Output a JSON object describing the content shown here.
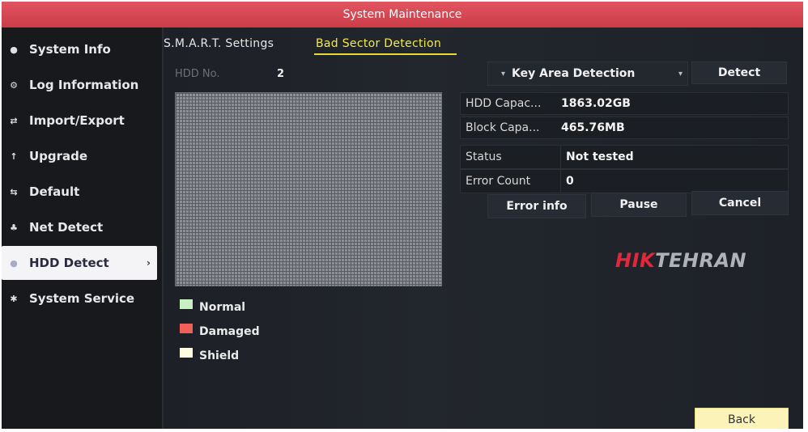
{
  "window": {
    "title": "System Maintenance"
  },
  "sidebar": {
    "items": [
      {
        "label": "System Info",
        "icon": "info-icon",
        "active": false
      },
      {
        "label": "Log Information",
        "icon": "log-icon",
        "active": false
      },
      {
        "label": "Import/Export",
        "icon": "import-export-icon",
        "active": false
      },
      {
        "label": "Upgrade",
        "icon": "upgrade-icon",
        "active": false
      },
      {
        "label": "Default",
        "icon": "default-icon",
        "active": false
      },
      {
        "label": "Net Detect",
        "icon": "network-icon",
        "active": false
      },
      {
        "label": "HDD Detect",
        "icon": "disk-icon",
        "active": true
      },
      {
        "label": "System Service",
        "icon": "gear-icon",
        "active": false
      }
    ]
  },
  "tabs": [
    {
      "label": "S.M.A.R.T. Settings",
      "active": false
    },
    {
      "label": "Bad Sector Detection",
      "active": true
    }
  ],
  "hdd": {
    "label": "HDD No.",
    "value": "2"
  },
  "detection": {
    "mode": "Key Area Detection",
    "detect_label": "Detect"
  },
  "info": {
    "capacity_label": "HDD Capac...",
    "capacity_value": "1863.02GB",
    "block_label": "Block Capa...",
    "block_value": "465.76MB",
    "status_label": "Status",
    "status_value": "Not tested",
    "error_count_label": "Error Count",
    "error_count_value": "0"
  },
  "actions": {
    "error_info": "Error info",
    "pause": "Pause",
    "cancel": "Cancel",
    "back": "Back"
  },
  "legend": [
    {
      "label": "Normal",
      "color": "#c8f0c0"
    },
    {
      "label": "Damaged",
      "color": "#f0605a"
    },
    {
      "label": "Shield",
      "color": "#fffbe0"
    }
  ],
  "watermark": {
    "part1": "HIK",
    "part2": "TEHRAN",
    "color1": "#e0283a",
    "color2": "#b0b2b8"
  }
}
